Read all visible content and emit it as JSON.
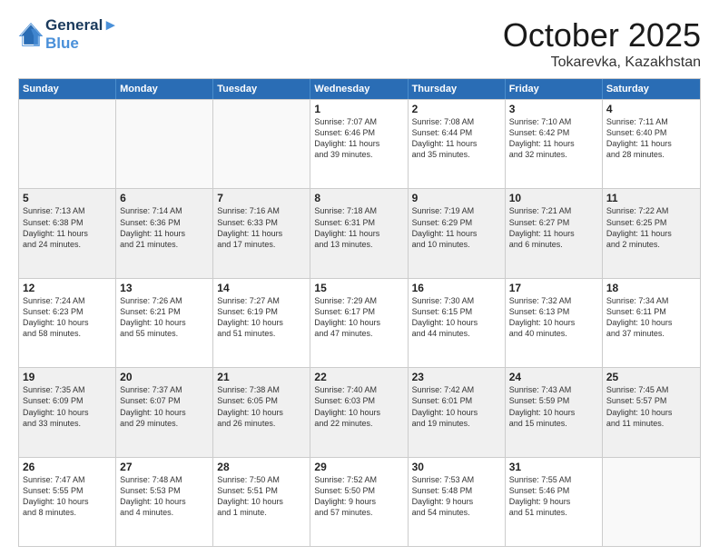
{
  "header": {
    "logo_line1": "General",
    "logo_line2": "Blue",
    "title": "October 2025",
    "subtitle": "Tokarevka, Kazakhstan"
  },
  "weekdays": [
    "Sunday",
    "Monday",
    "Tuesday",
    "Wednesday",
    "Thursday",
    "Friday",
    "Saturday"
  ],
  "weeks": [
    [
      {
        "day": "",
        "info": ""
      },
      {
        "day": "",
        "info": ""
      },
      {
        "day": "",
        "info": ""
      },
      {
        "day": "1",
        "info": "Sunrise: 7:07 AM\nSunset: 6:46 PM\nDaylight: 11 hours\nand 39 minutes."
      },
      {
        "day": "2",
        "info": "Sunrise: 7:08 AM\nSunset: 6:44 PM\nDaylight: 11 hours\nand 35 minutes."
      },
      {
        "day": "3",
        "info": "Sunrise: 7:10 AM\nSunset: 6:42 PM\nDaylight: 11 hours\nand 32 minutes."
      },
      {
        "day": "4",
        "info": "Sunrise: 7:11 AM\nSunset: 6:40 PM\nDaylight: 11 hours\nand 28 minutes."
      }
    ],
    [
      {
        "day": "5",
        "info": "Sunrise: 7:13 AM\nSunset: 6:38 PM\nDaylight: 11 hours\nand 24 minutes."
      },
      {
        "day": "6",
        "info": "Sunrise: 7:14 AM\nSunset: 6:36 PM\nDaylight: 11 hours\nand 21 minutes."
      },
      {
        "day": "7",
        "info": "Sunrise: 7:16 AM\nSunset: 6:33 PM\nDaylight: 11 hours\nand 17 minutes."
      },
      {
        "day": "8",
        "info": "Sunrise: 7:18 AM\nSunset: 6:31 PM\nDaylight: 11 hours\nand 13 minutes."
      },
      {
        "day": "9",
        "info": "Sunrise: 7:19 AM\nSunset: 6:29 PM\nDaylight: 11 hours\nand 10 minutes."
      },
      {
        "day": "10",
        "info": "Sunrise: 7:21 AM\nSunset: 6:27 PM\nDaylight: 11 hours\nand 6 minutes."
      },
      {
        "day": "11",
        "info": "Sunrise: 7:22 AM\nSunset: 6:25 PM\nDaylight: 11 hours\nand 2 minutes."
      }
    ],
    [
      {
        "day": "12",
        "info": "Sunrise: 7:24 AM\nSunset: 6:23 PM\nDaylight: 10 hours\nand 58 minutes."
      },
      {
        "day": "13",
        "info": "Sunrise: 7:26 AM\nSunset: 6:21 PM\nDaylight: 10 hours\nand 55 minutes."
      },
      {
        "day": "14",
        "info": "Sunrise: 7:27 AM\nSunset: 6:19 PM\nDaylight: 10 hours\nand 51 minutes."
      },
      {
        "day": "15",
        "info": "Sunrise: 7:29 AM\nSunset: 6:17 PM\nDaylight: 10 hours\nand 47 minutes."
      },
      {
        "day": "16",
        "info": "Sunrise: 7:30 AM\nSunset: 6:15 PM\nDaylight: 10 hours\nand 44 minutes."
      },
      {
        "day": "17",
        "info": "Sunrise: 7:32 AM\nSunset: 6:13 PM\nDaylight: 10 hours\nand 40 minutes."
      },
      {
        "day": "18",
        "info": "Sunrise: 7:34 AM\nSunset: 6:11 PM\nDaylight: 10 hours\nand 37 minutes."
      }
    ],
    [
      {
        "day": "19",
        "info": "Sunrise: 7:35 AM\nSunset: 6:09 PM\nDaylight: 10 hours\nand 33 minutes."
      },
      {
        "day": "20",
        "info": "Sunrise: 7:37 AM\nSunset: 6:07 PM\nDaylight: 10 hours\nand 29 minutes."
      },
      {
        "day": "21",
        "info": "Sunrise: 7:38 AM\nSunset: 6:05 PM\nDaylight: 10 hours\nand 26 minutes."
      },
      {
        "day": "22",
        "info": "Sunrise: 7:40 AM\nSunset: 6:03 PM\nDaylight: 10 hours\nand 22 minutes."
      },
      {
        "day": "23",
        "info": "Sunrise: 7:42 AM\nSunset: 6:01 PM\nDaylight: 10 hours\nand 19 minutes."
      },
      {
        "day": "24",
        "info": "Sunrise: 7:43 AM\nSunset: 5:59 PM\nDaylight: 10 hours\nand 15 minutes."
      },
      {
        "day": "25",
        "info": "Sunrise: 7:45 AM\nSunset: 5:57 PM\nDaylight: 10 hours\nand 11 minutes."
      }
    ],
    [
      {
        "day": "26",
        "info": "Sunrise: 7:47 AM\nSunset: 5:55 PM\nDaylight: 10 hours\nand 8 minutes."
      },
      {
        "day": "27",
        "info": "Sunrise: 7:48 AM\nSunset: 5:53 PM\nDaylight: 10 hours\nand 4 minutes."
      },
      {
        "day": "28",
        "info": "Sunrise: 7:50 AM\nSunset: 5:51 PM\nDaylight: 10 hours\nand 1 minute."
      },
      {
        "day": "29",
        "info": "Sunrise: 7:52 AM\nSunset: 5:50 PM\nDaylight: 9 hours\nand 57 minutes."
      },
      {
        "day": "30",
        "info": "Sunrise: 7:53 AM\nSunset: 5:48 PM\nDaylight: 9 hours\nand 54 minutes."
      },
      {
        "day": "31",
        "info": "Sunrise: 7:55 AM\nSunset: 5:46 PM\nDaylight: 9 hours\nand 51 minutes."
      },
      {
        "day": "",
        "info": ""
      }
    ]
  ]
}
